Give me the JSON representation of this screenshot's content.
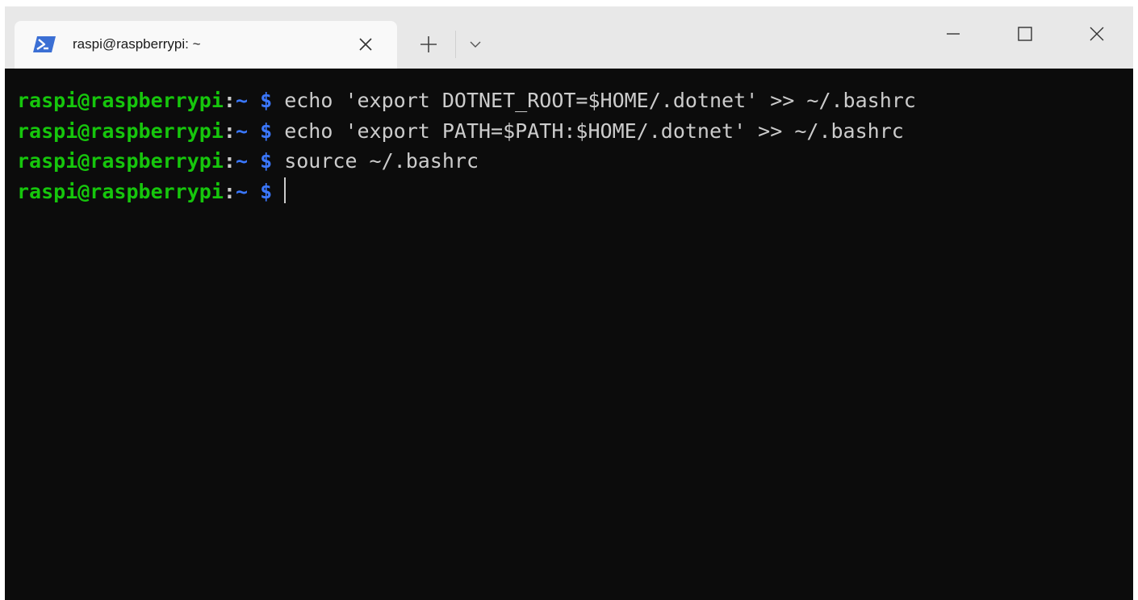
{
  "tab": {
    "title": "raspi@raspberrypi: ~",
    "icon": "powershell-icon",
    "accent_color": "#3b6fd4"
  },
  "titlebar_icons": {
    "close_tab": "close-icon",
    "new_tab": "plus-icon",
    "dropdown": "chevron-down-icon",
    "minimize": "minimize-icon",
    "maximize": "maximize-icon",
    "close_window": "close-icon"
  },
  "terminal": {
    "colors": {
      "background": "#0c0c0c",
      "user": "#16c60c",
      "path": "#3b78ff",
      "text": "#cccccc"
    },
    "lines": [
      {
        "user": "raspi@raspberrypi",
        "colon": ":",
        "path": "~",
        "dollar": "$",
        "command": "echo 'export DOTNET_ROOT=$HOME/.dotnet' >> ~/.bashrc"
      },
      {
        "user": "raspi@raspberrypi",
        "colon": ":",
        "path": "~",
        "dollar": "$",
        "command": "echo 'export PATH=$PATH:$HOME/.dotnet' >> ~/.bashrc"
      },
      {
        "user": "raspi@raspberrypi",
        "colon": ":",
        "path": "~",
        "dollar": "$",
        "command": "source ~/.bashrc"
      },
      {
        "user": "raspi@raspberrypi",
        "colon": ":",
        "path": "~",
        "dollar": "$",
        "command": ""
      }
    ]
  }
}
